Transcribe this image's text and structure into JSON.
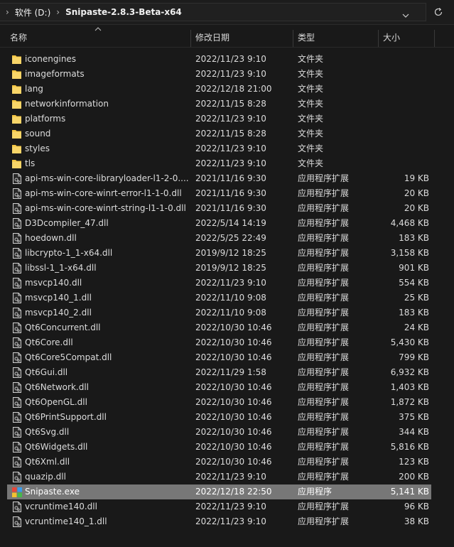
{
  "address": {
    "segments": [
      "软件 (D:)",
      "Snipaste-2.8.3-Beta-x64"
    ]
  },
  "columns": {
    "name": "名称",
    "date": "修改日期",
    "type": "类型",
    "size": "大小"
  },
  "colors": {
    "background": "#191919",
    "folder": "#f4c542",
    "selected_row": "#777777"
  },
  "files": [
    {
      "name": "iconengines",
      "date": "2022/11/23 9:10",
      "type": "文件夹",
      "size": "",
      "icon": "folder-icon"
    },
    {
      "name": "imageformats",
      "date": "2022/11/23 9:10",
      "type": "文件夹",
      "size": "",
      "icon": "folder-icon"
    },
    {
      "name": "lang",
      "date": "2022/12/18 21:00",
      "type": "文件夹",
      "size": "",
      "icon": "folder-icon"
    },
    {
      "name": "networkinformation",
      "date": "2022/11/15 8:28",
      "type": "文件夹",
      "size": "",
      "icon": "folder-icon"
    },
    {
      "name": "platforms",
      "date": "2022/11/23 9:10",
      "type": "文件夹",
      "size": "",
      "icon": "folder-icon"
    },
    {
      "name": "sound",
      "date": "2022/11/15 8:28",
      "type": "文件夹",
      "size": "",
      "icon": "folder-icon"
    },
    {
      "name": "styles",
      "date": "2022/11/23 9:10",
      "type": "文件夹",
      "size": "",
      "icon": "folder-icon"
    },
    {
      "name": "tls",
      "date": "2022/11/23 9:10",
      "type": "文件夹",
      "size": "",
      "icon": "folder-icon"
    },
    {
      "name": "api-ms-win-core-libraryloader-l1-2-0....",
      "date": "2021/11/16 9:30",
      "type": "应用程序扩展",
      "size": "19 KB",
      "icon": "dll-file-icon"
    },
    {
      "name": "api-ms-win-core-winrt-error-l1-1-0.dll",
      "date": "2021/11/16 9:30",
      "type": "应用程序扩展",
      "size": "20 KB",
      "icon": "dll-file-icon"
    },
    {
      "name": "api-ms-win-core-winrt-string-l1-1-0.dll",
      "date": "2021/11/16 9:30",
      "type": "应用程序扩展",
      "size": "20 KB",
      "icon": "dll-file-icon"
    },
    {
      "name": "D3Dcompiler_47.dll",
      "date": "2022/5/14 14:19",
      "type": "应用程序扩展",
      "size": "4,468 KB",
      "icon": "dll-file-icon"
    },
    {
      "name": "hoedown.dll",
      "date": "2022/5/25 22:49",
      "type": "应用程序扩展",
      "size": "183 KB",
      "icon": "dll-file-icon"
    },
    {
      "name": "libcrypto-1_1-x64.dll",
      "date": "2019/9/12 18:25",
      "type": "应用程序扩展",
      "size": "3,158 KB",
      "icon": "dll-file-icon"
    },
    {
      "name": "libssl-1_1-x64.dll",
      "date": "2019/9/12 18:25",
      "type": "应用程序扩展",
      "size": "901 KB",
      "icon": "dll-file-icon"
    },
    {
      "name": "msvcp140.dll",
      "date": "2022/11/23 9:10",
      "type": "应用程序扩展",
      "size": "554 KB",
      "icon": "dll-file-icon"
    },
    {
      "name": "msvcp140_1.dll",
      "date": "2022/11/10 9:08",
      "type": "应用程序扩展",
      "size": "25 KB",
      "icon": "dll-file-icon"
    },
    {
      "name": "msvcp140_2.dll",
      "date": "2022/11/10 9:08",
      "type": "应用程序扩展",
      "size": "183 KB",
      "icon": "dll-file-icon"
    },
    {
      "name": "Qt6Concurrent.dll",
      "date": "2022/10/30 10:46",
      "type": "应用程序扩展",
      "size": "24 KB",
      "icon": "dll-file-icon"
    },
    {
      "name": "Qt6Core.dll",
      "date": "2022/10/30 10:46",
      "type": "应用程序扩展",
      "size": "5,430 KB",
      "icon": "dll-file-icon"
    },
    {
      "name": "Qt6Core5Compat.dll",
      "date": "2022/10/30 10:46",
      "type": "应用程序扩展",
      "size": "799 KB",
      "icon": "dll-file-icon"
    },
    {
      "name": "Qt6Gui.dll",
      "date": "2022/11/29 1:58",
      "type": "应用程序扩展",
      "size": "6,932 KB",
      "icon": "dll-file-icon"
    },
    {
      "name": "Qt6Network.dll",
      "date": "2022/10/30 10:46",
      "type": "应用程序扩展",
      "size": "1,403 KB",
      "icon": "dll-file-icon"
    },
    {
      "name": "Qt6OpenGL.dll",
      "date": "2022/10/30 10:46",
      "type": "应用程序扩展",
      "size": "1,872 KB",
      "icon": "dll-file-icon"
    },
    {
      "name": "Qt6PrintSupport.dll",
      "date": "2022/10/30 10:46",
      "type": "应用程序扩展",
      "size": "375 KB",
      "icon": "dll-file-icon"
    },
    {
      "name": "Qt6Svg.dll",
      "date": "2022/10/30 10:46",
      "type": "应用程序扩展",
      "size": "344 KB",
      "icon": "dll-file-icon"
    },
    {
      "name": "Qt6Widgets.dll",
      "date": "2022/10/30 10:46",
      "type": "应用程序扩展",
      "size": "5,816 KB",
      "icon": "dll-file-icon"
    },
    {
      "name": "Qt6Xml.dll",
      "date": "2022/10/30 10:46",
      "type": "应用程序扩展",
      "size": "123 KB",
      "icon": "dll-file-icon"
    },
    {
      "name": "quazip.dll",
      "date": "2022/11/23 9:10",
      "type": "应用程序扩展",
      "size": "200 KB",
      "icon": "dll-file-icon"
    },
    {
      "name": "Snipaste.exe",
      "date": "2022/12/18 22:50",
      "type": "应用程序",
      "size": "5,141 KB",
      "icon": "snipaste-app-icon",
      "selected": true
    },
    {
      "name": "vcruntime140.dll",
      "date": "2022/11/23 9:10",
      "type": "应用程序扩展",
      "size": "96 KB",
      "icon": "dll-file-icon"
    },
    {
      "name": "vcruntime140_1.dll",
      "date": "2022/11/23 9:10",
      "type": "应用程序扩展",
      "size": "38 KB",
      "icon": "dll-file-icon"
    }
  ]
}
